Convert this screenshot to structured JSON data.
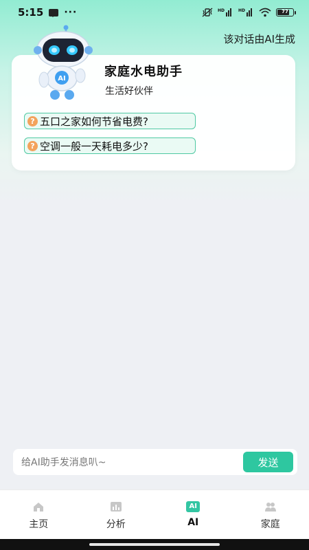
{
  "status_bar": {
    "time": "5:15",
    "dots": "···",
    "battery": "77"
  },
  "header": {
    "ai_note": "该对话由AI生成"
  },
  "intro": {
    "title": "家庭水电助手",
    "subtitle": "生活好伙伴",
    "suggestions": [
      {
        "label": "五口之家如何节省电费?"
      },
      {
        "label": "空调一般一天耗电多少?"
      }
    ]
  },
  "composer": {
    "placeholder": "给AI助手发消息叭~",
    "send_label": "发送"
  },
  "nav": {
    "items": [
      {
        "label": "主页",
        "icon": "home-icon"
      },
      {
        "label": "分析",
        "icon": "chart-icon"
      },
      {
        "label": "AI",
        "icon": "ai-icon",
        "active": true
      },
      {
        "label": "家庭",
        "icon": "family-icon"
      }
    ]
  },
  "colors": {
    "accent": "#2ec7a0",
    "suggest_border": "#4ec9a2",
    "question_icon": "#f3a35c"
  }
}
